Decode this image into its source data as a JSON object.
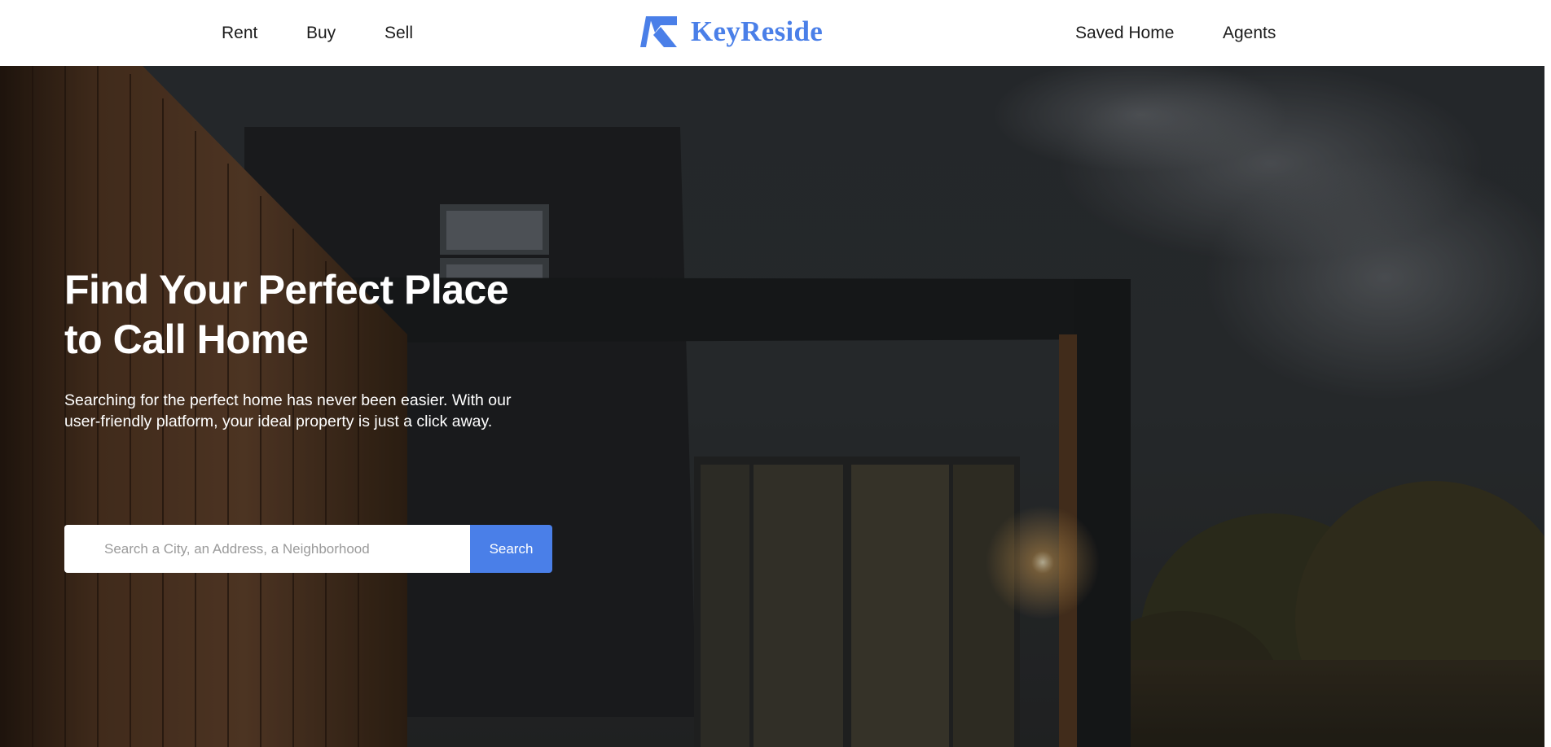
{
  "header": {
    "nav_left": [
      {
        "label": "Rent"
      },
      {
        "label": "Buy"
      },
      {
        "label": "Sell"
      }
    ],
    "logo": {
      "text": "KeyReside",
      "icon": "k-logo-icon",
      "color": "#4a7fe8"
    },
    "nav_right": [
      {
        "label": "Saved Home"
      },
      {
        "label": "Agents"
      }
    ]
  },
  "hero": {
    "title_lines": [
      "Find Your Perfect Place",
      "to Call Home"
    ],
    "subtitle_lines": [
      "Searching for the perfect home has never been easier. With our",
      "user-friendly platform, your ideal property is just a click away."
    ],
    "background": "modern-house-photo"
  },
  "search": {
    "placeholder": "Search a City, an Address, a Neighborhood",
    "value": "",
    "button_label": "Search"
  },
  "colors": {
    "accent": "#4a7fe8",
    "text_dark": "#1c1c1c",
    "hero_text": "#ffffff"
  }
}
